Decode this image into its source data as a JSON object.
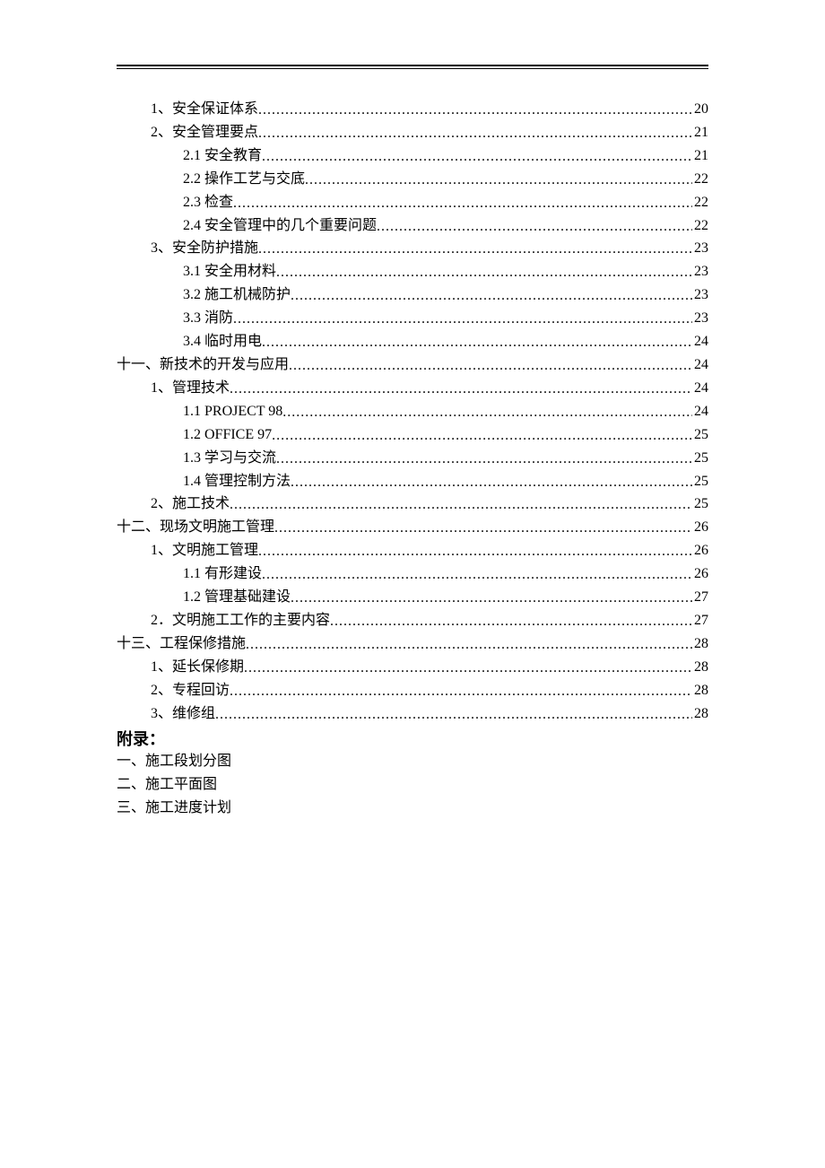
{
  "toc": [
    {
      "level": 1,
      "title": "1、安全保证体系",
      "page": "20"
    },
    {
      "level": 1,
      "title": "2、安全管理要点",
      "page": "21"
    },
    {
      "level": 2,
      "title": "2.1  安全教育",
      "page": "21"
    },
    {
      "level": 2,
      "title": "2.2  操作工艺与交底",
      "page": "22"
    },
    {
      "level": 2,
      "title": "2.3 检查",
      "page": "22"
    },
    {
      "level": 2,
      "title": "2.4  安全管理中的几个重要问题",
      "page": "22"
    },
    {
      "level": 1,
      "title": "3、安全防护措施",
      "page": "23"
    },
    {
      "level": 2,
      "title": "3.1 安全用材料",
      "page": "23"
    },
    {
      "level": 2,
      "title": "3.2  施工机械防护",
      "page": "23"
    },
    {
      "level": 2,
      "title": "3.3  消防",
      "page": "23"
    },
    {
      "level": 2,
      "title": "3.4  临时用电",
      "page": "24"
    },
    {
      "level": 0,
      "title": "十一、新技术的开发与应用",
      "page": "24"
    },
    {
      "level": 1,
      "title": "1、管理技术",
      "page": "24"
    },
    {
      "level": 2,
      "title": "1.1    PROJECT 98",
      "page": "24"
    },
    {
      "level": 2,
      "title": "1.2    OFFICE 97",
      "page": "25"
    },
    {
      "level": 2,
      "title": "1.3  学习与交流",
      "page": "25"
    },
    {
      "level": 2,
      "title": "1.4  管理控制方法",
      "page": "25"
    },
    {
      "level": 1,
      "title": "2、施工技术",
      "page": "25"
    },
    {
      "level": 0,
      "title": "十二、现场文明施工管理",
      "page": "26"
    },
    {
      "level": 1,
      "title": "1、文明施工管理",
      "page": "26"
    },
    {
      "level": 2,
      "title": "1.1  有形建设",
      "page": "26"
    },
    {
      "level": 2,
      "title": "1.2  管理基础建设",
      "page": "27"
    },
    {
      "level": 1,
      "title": "2．文明施工工作的主要内容",
      "page": "27"
    },
    {
      "level": 0,
      "title": "十三、工程保修措施",
      "page": "28"
    },
    {
      "level": 1,
      "title": "1、延长保修期",
      "page": "28"
    },
    {
      "level": 1,
      "title": "2、专程回访",
      "page": "28"
    },
    {
      "level": 1,
      "title": "3、维修组",
      "page": "28"
    }
  ],
  "appendix": {
    "heading": "附录：",
    "items": [
      "一、施工段划分图",
      "二、施工平面图",
      "三、施工进度计划"
    ]
  }
}
